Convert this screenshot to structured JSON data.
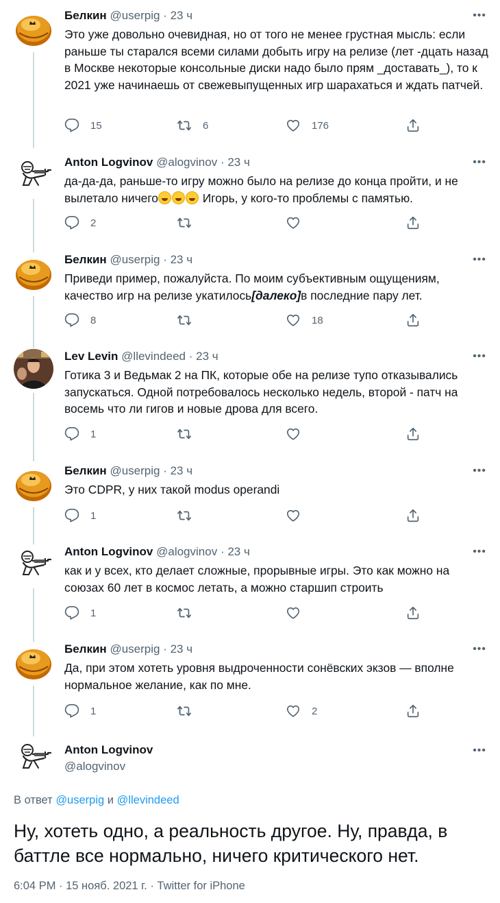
{
  "tweets": [
    {
      "name": "Белкин",
      "handle": "@userpig",
      "dot": "·",
      "time": "23 ч",
      "text": "Это уже довольно очевидная, но от того не менее грустная мысль: если раньше ты старался всеми силами добыть игру на релизе (лет -дцать назад в Москве некоторые консольные диски надо было прям _доставать_), то к 2021 уже начинаешь от свежевыпущенных игр шарахаться и ждать патчей.",
      "replies": "15",
      "retweets": "6",
      "likes": "176"
    },
    {
      "name": "Anton Logvinov",
      "handle": "@alogvinov",
      "dot": "·",
      "time": "23 ч",
      "text_a": "да-да-да, раньше-то игру можно было на релизе до конца пройти, и не вылетало ничего",
      "text_b": " Игорь, у кого-то проблемы с памятью.",
      "replies": "2",
      "retweets": "",
      "likes": ""
    },
    {
      "name": "Белкин",
      "handle": "@userpig",
      "dot": "·",
      "time": "23 ч",
      "text_a": "Приведи пример, пожалуйста. По моим субъективным ощущениям, качество игр на релизе укатилось",
      "text_em": "[далеко]",
      "text_b": "в последние пару лет.",
      "replies": "8",
      "retweets": "",
      "likes": "18"
    },
    {
      "name": "Lev Levin",
      "handle": "@llevindeed",
      "dot": "·",
      "time": "23 ч",
      "text": "Готика 3 и Ведьмак 2 на ПК, которые обе на релизе тупо отказывались запускаться. Одной потребовалось несколько недель, второй - патч на восемь что ли гигов и новые дрова для всего.",
      "replies": "1",
      "retweets": "",
      "likes": ""
    },
    {
      "name": "Белкин",
      "handle": "@userpig",
      "dot": "·",
      "time": "23 ч",
      "text": "Это CDPR, у них такой modus operandi",
      "replies": "1",
      "retweets": "",
      "likes": ""
    },
    {
      "name": "Anton Logvinov",
      "handle": "@alogvinov",
      "dot": "·",
      "time": "23 ч",
      "text": "как и у всех, кто делает сложные, прорывные игры. Это как можно на союзах 60 лет в космос летать, а можно старшип строить",
      "replies": "1",
      "retweets": "",
      "likes": ""
    },
    {
      "name": "Белкин",
      "handle": "@userpig",
      "dot": "·",
      "time": "23 ч",
      "text": "Да, при этом хотеть уровня выдроченности сонёвских экзов — вполне нормальное желание, как по мне.",
      "replies": "1",
      "retweets": "",
      "likes": "2"
    }
  ],
  "main": {
    "name": "Anton Logvinov",
    "handle": "@alogvinov",
    "reply_prefix": "В ответ ",
    "reply_user1": "@userpig",
    "reply_and": " и ",
    "reply_user2": "@llevindeed",
    "text": "Ну, хотеть одно, а реальность другое. Ну, правда, в баттле все нормально, ничего критического нет.",
    "meta": "6:04 PM · 15 нояб. 2021 г. · Twitter for iPhone"
  },
  "more_label": "•••",
  "colors": {
    "text": "#0f1419",
    "secondary": "#536471",
    "link": "#1d9bf0",
    "thread_line": "#cfd9de"
  },
  "icons": {
    "reply": "reply-icon",
    "retweet": "retweet-icon",
    "like": "heart-icon",
    "share": "share-icon"
  }
}
